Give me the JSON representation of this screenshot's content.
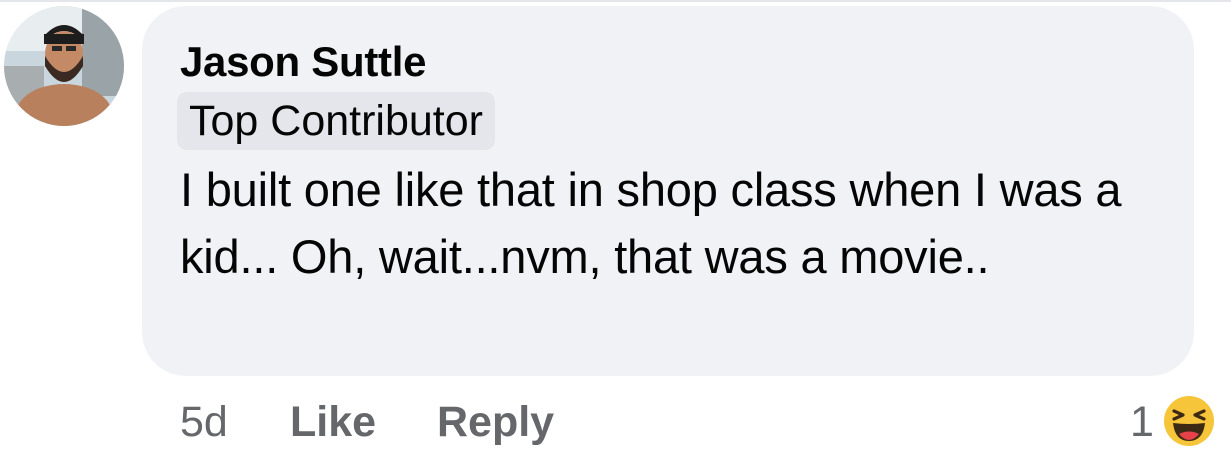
{
  "comment": {
    "author": "Jason Suttle",
    "badge": "Top Contributor",
    "text": "I built one like that in shop class when I was a kid... Oh, wait...nvm, that was a movie.."
  },
  "actions": {
    "time": "5d",
    "like_label": "Like",
    "reply_label": "Reply"
  },
  "reactions": {
    "count": "1",
    "icon": "haha-emoji-icon"
  },
  "colors": {
    "bubble": "#f0f2f5",
    "badge": "#e4e6eb",
    "text": "#050505",
    "secondary": "#65676b"
  }
}
